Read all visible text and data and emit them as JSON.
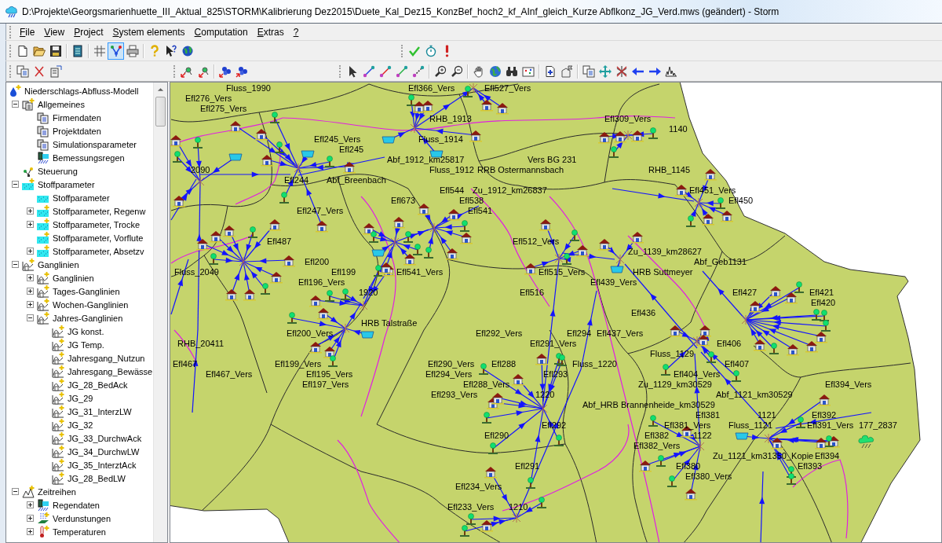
{
  "window": {
    "title": "D:\\Projekte\\Georgsmarienhuette_III_Aktual_825\\STORM\\Kalibrierung Dez2015\\Duete_Kal_Dez15_KonzBef_hoch2_kf_AInf_gleich_Kurze Abflkonz_JG_Verd.mws (geändert) - Storm"
  },
  "menu": [
    "File",
    "View",
    "Project",
    "System elements",
    "Computation",
    "Extras",
    "?"
  ],
  "toolbar_toggles": [
    {
      "pressed": false
    },
    {
      "pressed": true
    }
  ],
  "tree": {
    "label": "Niederschlags-Abfluss-Modell",
    "children": [
      {
        "label": "Allgemeines",
        "expanded": true,
        "children": [
          {
            "label": "Firmendaten"
          },
          {
            "label": "Projektdaten"
          },
          {
            "label": "Simulationsparameter"
          },
          {
            "label": "Bemessungsregen"
          }
        ]
      },
      {
        "label": "Steuerung"
      },
      {
        "label": "Stoffparameter",
        "expanded": true,
        "children": [
          {
            "label": "Stoffparameter"
          },
          {
            "label": "Stoffparameter, Regenw",
            "expanded": false
          },
          {
            "label": "Stoffparameter, Trocke",
            "expanded": false
          },
          {
            "label": "Stoffparameter, Vorflute"
          },
          {
            "label": "Stoffparameter, Absetzv",
            "expanded": false
          }
        ]
      },
      {
        "label": "Ganglinien",
        "expanded": true,
        "children": [
          {
            "label": "Ganglinien",
            "expanded": false
          },
          {
            "label": "Tages-Ganglinien",
            "expanded": false
          },
          {
            "label": "Wochen-Ganglinien",
            "expanded": false
          },
          {
            "label": "Jahres-Ganglinien",
            "expanded": true,
            "children": [
              {
                "label": "JG konst."
              },
              {
                "label": "JG Temp."
              },
              {
                "label": "Jahresgang_Nutzun"
              },
              {
                "label": "Jahresgang_Bewässe"
              },
              {
                "label": "JG_28_BedAck"
              },
              {
                "label": "JG_29"
              },
              {
                "label": "JG_31_InterzLW"
              },
              {
                "label": "JG_32"
              },
              {
                "label": "JG_33_DurchwAck"
              },
              {
                "label": "JG_34_DurchwLW"
              },
              {
                "label": "JG_35_InterztAck"
              },
              {
                "label": "JG_28_BedLW"
              }
            ]
          }
        ]
      },
      {
        "label": "Zeitreihen",
        "expanded": true,
        "children": [
          {
            "label": "Regendaten",
            "expanded": false
          },
          {
            "label": "Verdunstungen",
            "expanded": false
          },
          {
            "label": "Temperaturen",
            "expanded": false
          }
        ]
      }
    ]
  },
  "map": {
    "labels": [
      "Fluss_1990",
      "Efl366_Vers",
      "Efl527_Vers",
      "Efl276_Vers",
      "Efl275_Vers",
      "RHB_1913",
      "Efl309_Vers",
      "1140",
      "Efl245_Vers",
      "Fluss_1914",
      "Efl245",
      "Abf_1912_km25817",
      "Vers BG 231",
      "2090",
      "Fluss_1912",
      "RRB Ostermannsbach",
      "RHB_1145",
      "Efl244",
      "Abf_Breenbach",
      "Efl544",
      "Zu_1912_km26837",
      "Efl451_Vers",
      "Efl673",
      "Efl538",
      "Efl450",
      "Efl247_Vers",
      "Efl541",
      "Efl487",
      "Efl512_Vers",
      "Zu_1139_km28627",
      "Efl200",
      "Abf_Geb1131",
      "Fluss_2049",
      "Efl199",
      "Efl541_Vers",
      "Efl515_Vers",
      "HRB Suttmeyer",
      "Efl196_Vers",
      "Efl439_Vers",
      "1920",
      "Efl516",
      "Efl427",
      "Efl421",
      "Efl420",
      "Efl436",
      "HRB Talstraße",
      "Efl200_Vers",
      "Efl292_Vers",
      "Efl294",
      "Efl437_Vers",
      "RHB_20411",
      "Efl291_Vers",
      "Efl406",
      "Fluss_1129",
      "Efl467",
      "Efl199_Vers",
      "Efl290_Vers",
      "Efl288",
      "Fluss_1220",
      "Efl407",
      "Efl467_Vers",
      "Efl195_Vers",
      "Efl294_Vers",
      "Efl293",
      "Efl404_Vers",
      "Efl197_Vers",
      "Efl288_Vers",
      "Zu_1129_km30529",
      "Efl394_Vers",
      "Efl293_Vers",
      "1220",
      "Abf_1121_km30529",
      "Abf_HRB Brannenheide_km30529",
      "Efl381",
      "1121",
      "Efl392",
      "Efl292",
      "Efl381_Vers",
      "Fluss_1121",
      "Efl391_Vers",
      "177_2837",
      "Efl290",
      "Efl382",
      "1122",
      "Efl382_Vers",
      "Zu_1121_km31350_Kopie",
      "Efl394",
      "Efl291",
      "Efl380",
      "Efl393",
      "Efl380_Vers",
      "Efl234_Vers",
      "Efl233_Vers",
      "1210"
    ]
  }
}
